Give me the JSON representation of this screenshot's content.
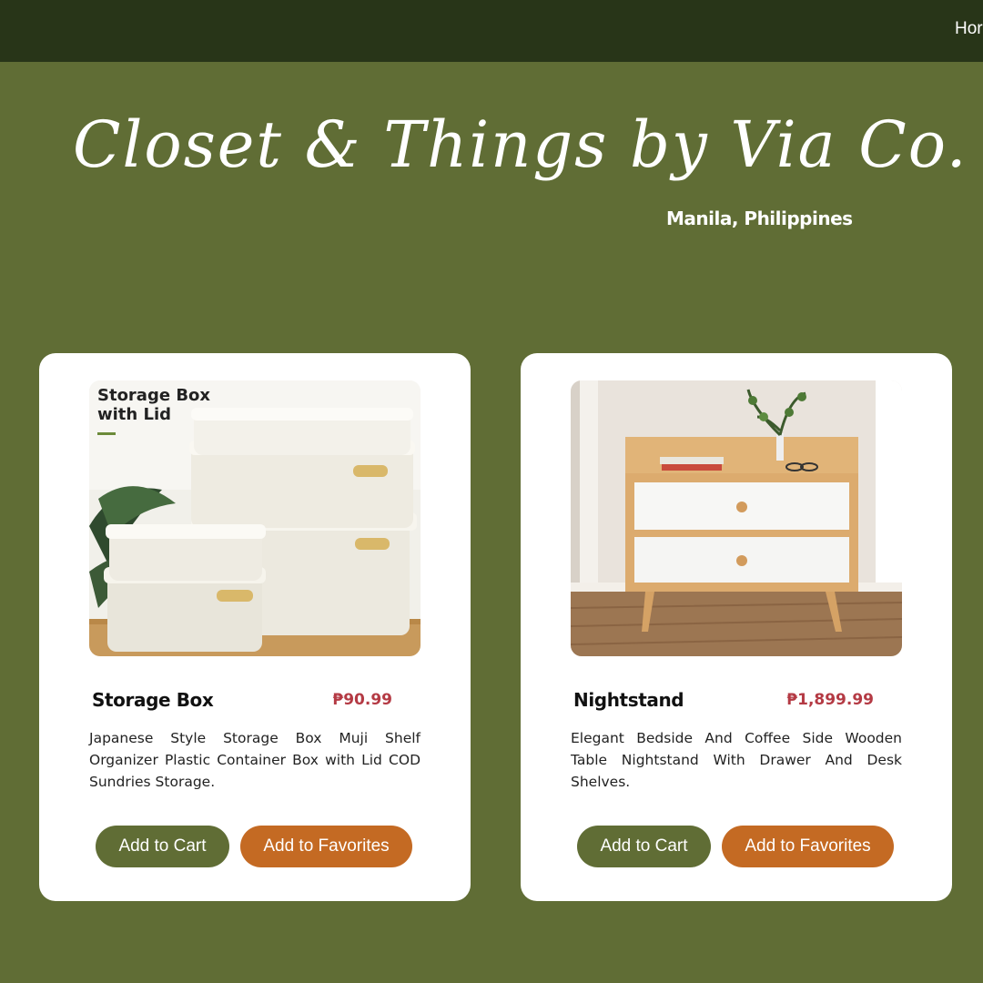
{
  "nav": {
    "links": [
      "Hor"
    ]
  },
  "header": {
    "brand": "Closet & Things by Via Co.",
    "location": "Manila, Philippines"
  },
  "products": [
    {
      "name": "Storage Box",
      "price": "₱90.99",
      "image_caption": "Storage Box\nwith Lid",
      "description": "Japanese Style Storage Box Muji Shelf Organizer Plastic Container Box with Lid COD Sundries Storage.",
      "add_to_cart": "Add to Cart",
      "add_to_favorites": "Add to Favorites"
    },
    {
      "name": "Nightstand",
      "price": "₱1,899.99",
      "description": "Elegant Bedside And Coffee Side Wooden Table Nightstand With Drawer And Desk Shelves.",
      "add_to_cart": "Add to Cart",
      "add_to_favorites": "Add to Favorites"
    }
  ],
  "colors": {
    "navbar": "#283518",
    "page_background": "#606d35",
    "cart_button": "#606d35",
    "favorites_button": "#c46a23",
    "price": "#b43a44"
  }
}
